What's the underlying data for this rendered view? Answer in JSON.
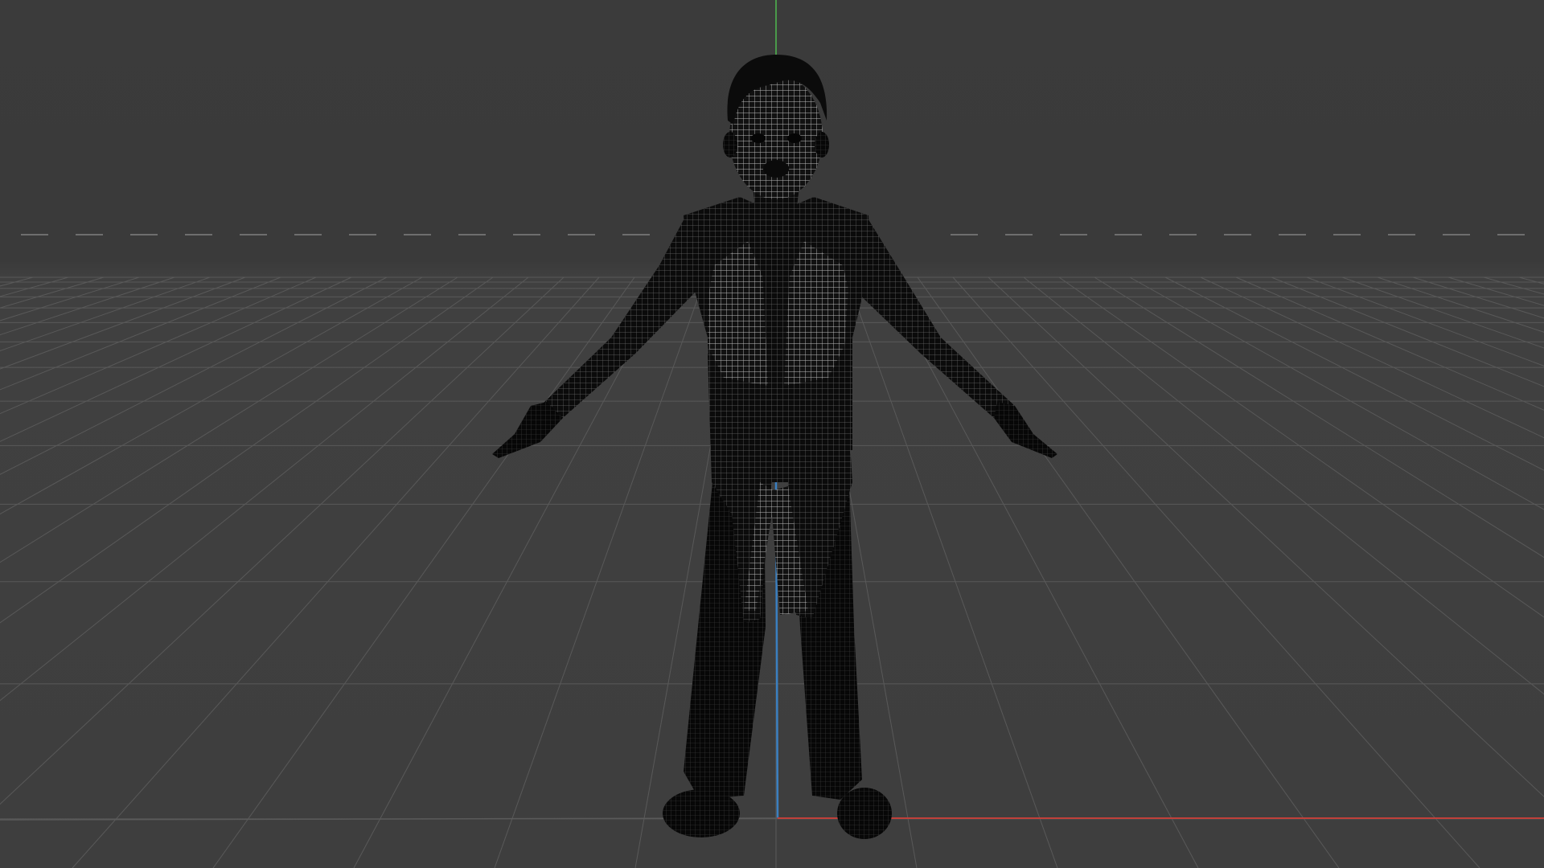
{
  "viewport": {
    "background_color": "#3b3b3b",
    "grid_color": "#595959",
    "horizon_dash_color": "#6e6e6e",
    "axis_colors": {
      "x": "#c0403a",
      "y": "#4a9a4a",
      "z": "#3a7fc0"
    },
    "model": {
      "name": "character-wireframe",
      "pose": "T-pose",
      "display_mode": "wireframe",
      "mesh_color": "#0a0a0a",
      "wire_highlight_color": "#bdbdbd"
    }
  }
}
